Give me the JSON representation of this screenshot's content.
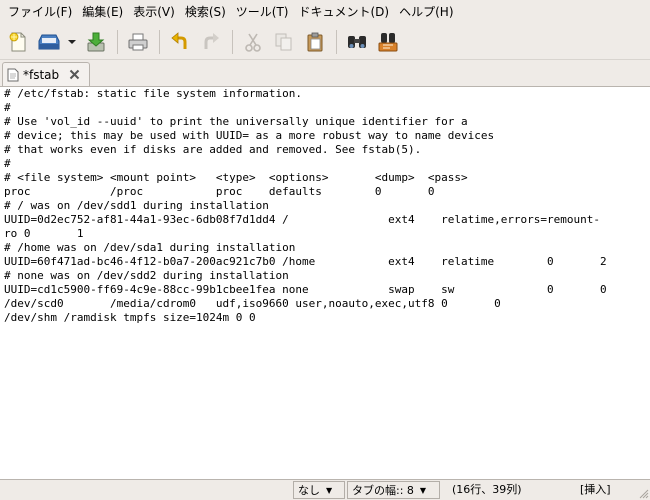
{
  "menubar": {
    "items": [
      "ファイル(F)",
      "編集(E)",
      "表示(V)",
      "検索(S)",
      "ツール(T)",
      "ドキュメント(D)",
      "ヘルプ(H)"
    ]
  },
  "toolbar": {
    "buttons": [
      "new-document-icon",
      "save-icon",
      "save-dropdown-arrow",
      "download-save-icon",
      "print-icon",
      "undo-icon",
      "redo-icon",
      "cut-icon",
      "copy-icon",
      "paste-icon",
      "find-icon",
      "replace-icon"
    ]
  },
  "tab": {
    "title": "*fstab"
  },
  "editor": {
    "lines": [
      "# /etc/fstab: static file system information.",
      "#",
      "# Use 'vol_id --uuid' to print the universally unique identifier for a",
      "# device; this may be used with UUID= as a more robust way to name devices",
      "# that works even if disks are added and removed. See fstab(5).",
      "#",
      "# <file system> <mount point>   <type>  <options>       <dump>  <pass>",
      "proc            /proc           proc    defaults        0       0",
      "# / was on /dev/sdd1 during installation",
      "UUID=0d2ec752-af81-44a1-93ec-6db08f7d1dd4 /               ext4    relatime,errors=remount-",
      "ro 0       1",
      "# /home was on /dev/sda1 during installation",
      "UUID=60f471ad-bc46-4f12-b0a7-200ac921c7b0 /home           ext4    relatime        0       2",
      "# none was on /dev/sdd2 during installation",
      "UUID=cd1c5900-ff69-4c9e-88cc-99b1cbee1fea none            swap    sw              0       0",
      "/dev/scd0       /media/cdrom0   udf,iso9660 user,noauto,exec,utf8 0       0",
      "/dev/shm /ramdisk tmpfs size=1024m 0 0"
    ]
  },
  "statusbar": {
    "highlight": "なし",
    "tab_width": "タブの幅:: 8",
    "position": "(16行、39列)",
    "mode": "[挿入]"
  }
}
